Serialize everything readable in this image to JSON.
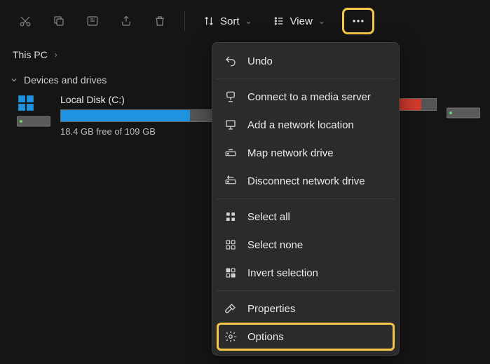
{
  "toolbar": {
    "sort_label": "Sort",
    "view_label": "View"
  },
  "breadcrumb": {
    "root": "This PC"
  },
  "section": {
    "devices_label": "Devices and drives"
  },
  "drives": [
    {
      "name": "Local Disk (C:)",
      "free_text": "18.4 GB free of 109 GB",
      "used_percent": 83,
      "fill_color": "#1f93e0"
    },
    {
      "name": "",
      "free_text": "",
      "used_percent": 92,
      "fill_color": "#d33a2f"
    }
  ],
  "menu": {
    "undo": "Undo",
    "connect_media": "Connect to a media server",
    "add_network_loc": "Add a network location",
    "map_drive": "Map network drive",
    "disconnect_drive": "Disconnect network drive",
    "select_all": "Select all",
    "select_none": "Select none",
    "invert_selection": "Invert selection",
    "properties": "Properties",
    "options": "Options"
  }
}
